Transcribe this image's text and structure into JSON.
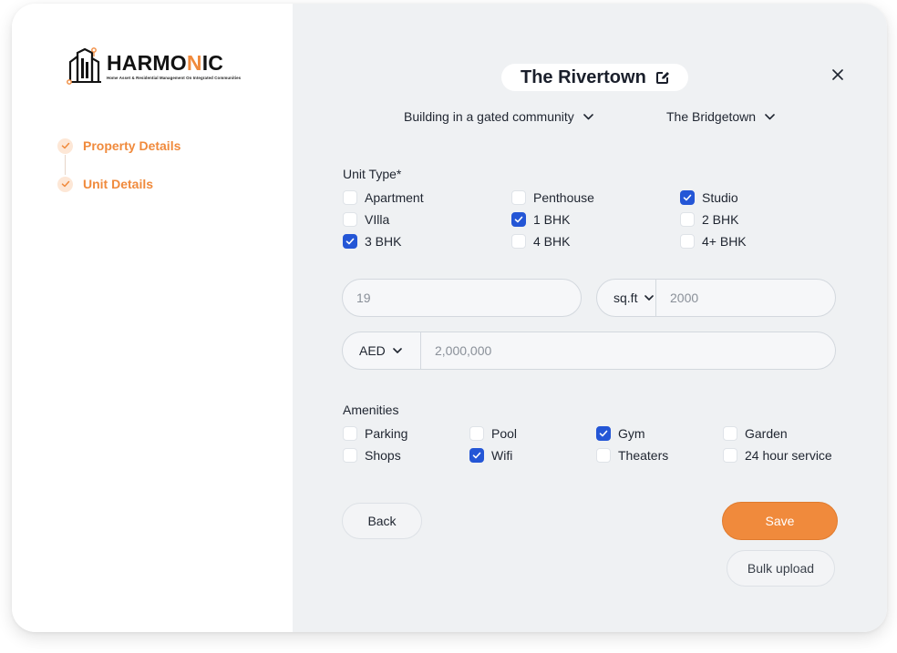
{
  "brand": {
    "name_part1": "HARMO",
    "name_accent": "N",
    "name_part2": "IC",
    "tagline": "Home Asset & Residential Management On Integrated Communities",
    "accent_color": "#f08a3c"
  },
  "steps": [
    {
      "label": "Property Details",
      "done": true
    },
    {
      "label": "Unit Details",
      "done": true
    }
  ],
  "header": {
    "title": "The Rivertown",
    "edit_icon": "edit-icon",
    "close_icon": "close-icon"
  },
  "filters": {
    "building_type": "Building in a gated community",
    "community": "The Bridgetown"
  },
  "unit_type": {
    "label": "Unit Type*",
    "options": [
      {
        "label": "Apartment",
        "checked": false
      },
      {
        "label": "Penthouse",
        "checked": false
      },
      {
        "label": "Studio",
        "checked": true
      },
      {
        "label": "VIlla",
        "checked": false
      },
      {
        "label": "1 BHK",
        "checked": true
      },
      {
        "label": "2 BHK",
        "checked": false
      },
      {
        "label": "3 BHK",
        "checked": true
      },
      {
        "label": "4 BHK",
        "checked": false
      },
      {
        "label": "4+ BHK",
        "checked": false
      }
    ]
  },
  "fields": {
    "unit_number": {
      "placeholder": "19"
    },
    "area_unit": "sq.ft",
    "area": {
      "placeholder": "2000"
    },
    "currency": "AED",
    "price": {
      "placeholder": "2,000,000"
    }
  },
  "amenities": {
    "label": "Amenities",
    "options": [
      {
        "label": "Parking",
        "checked": false
      },
      {
        "label": "Pool",
        "checked": false
      },
      {
        "label": "Gym",
        "checked": true
      },
      {
        "label": "Garden",
        "checked": false
      },
      {
        "label": "Shops",
        "checked": false
      },
      {
        "label": "Wifi",
        "checked": true
      },
      {
        "label": "Theaters",
        "checked": false
      },
      {
        "label": "24 hour service",
        "checked": false
      }
    ]
  },
  "actions": {
    "back": "Back",
    "save": "Save",
    "bulk_upload": "Bulk upload"
  },
  "colors": {
    "checkbox_checked": "#2456d6",
    "main_background": "#eff1f3"
  }
}
